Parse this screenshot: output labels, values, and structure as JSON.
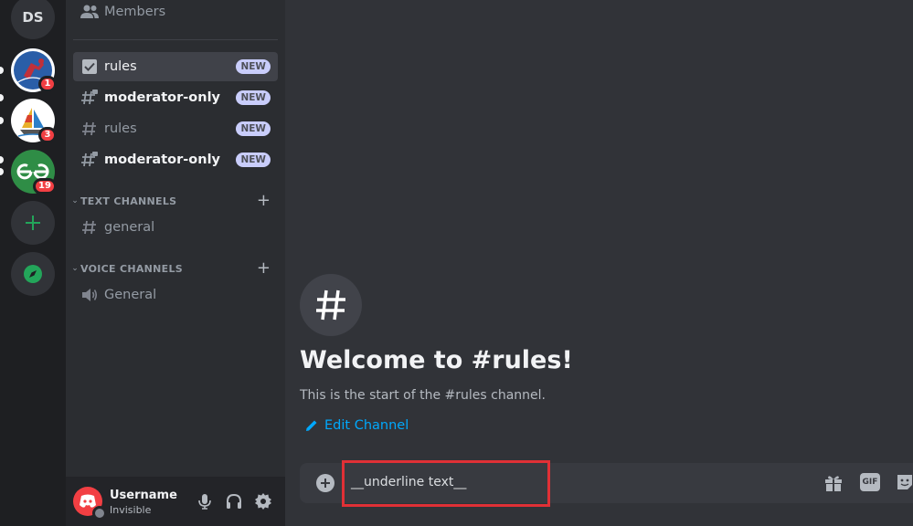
{
  "servers": [
    {
      "name": "DS",
      "abbr": "DS"
    },
    {
      "name": "spider-server",
      "badge": "1"
    },
    {
      "name": "sailboat-server",
      "badge": "3"
    },
    {
      "name": "geeksforgeeks-server",
      "badge": "19"
    }
  ],
  "sidebar": {
    "members_label": "Members",
    "channels": [
      {
        "label": "rules",
        "badge": "NEW"
      },
      {
        "label": "moderator-only",
        "badge": "NEW"
      },
      {
        "label": "rules",
        "badge": "NEW"
      },
      {
        "label": "moderator-only",
        "badge": "NEW"
      }
    ],
    "text_category": "TEXT CHANNELS",
    "text_channels": [
      {
        "label": "general"
      }
    ],
    "voice_category": "VOICE CHANNELS",
    "voice_channels": [
      {
        "label": "General"
      }
    ]
  },
  "user": {
    "name": "Username",
    "status": "Invisible"
  },
  "welcome": {
    "title": "Welcome to #rules!",
    "subtitle": "This is the start of the #rules channel.",
    "edit_label": "Edit Channel"
  },
  "composer": {
    "value": "__underline text__",
    "gif_label": "GIF"
  },
  "colors": {
    "accent": "#5865f2",
    "highlight": "#e03036",
    "link": "#00a8fc",
    "green": "#23a55a",
    "danger": "#f23f43"
  }
}
